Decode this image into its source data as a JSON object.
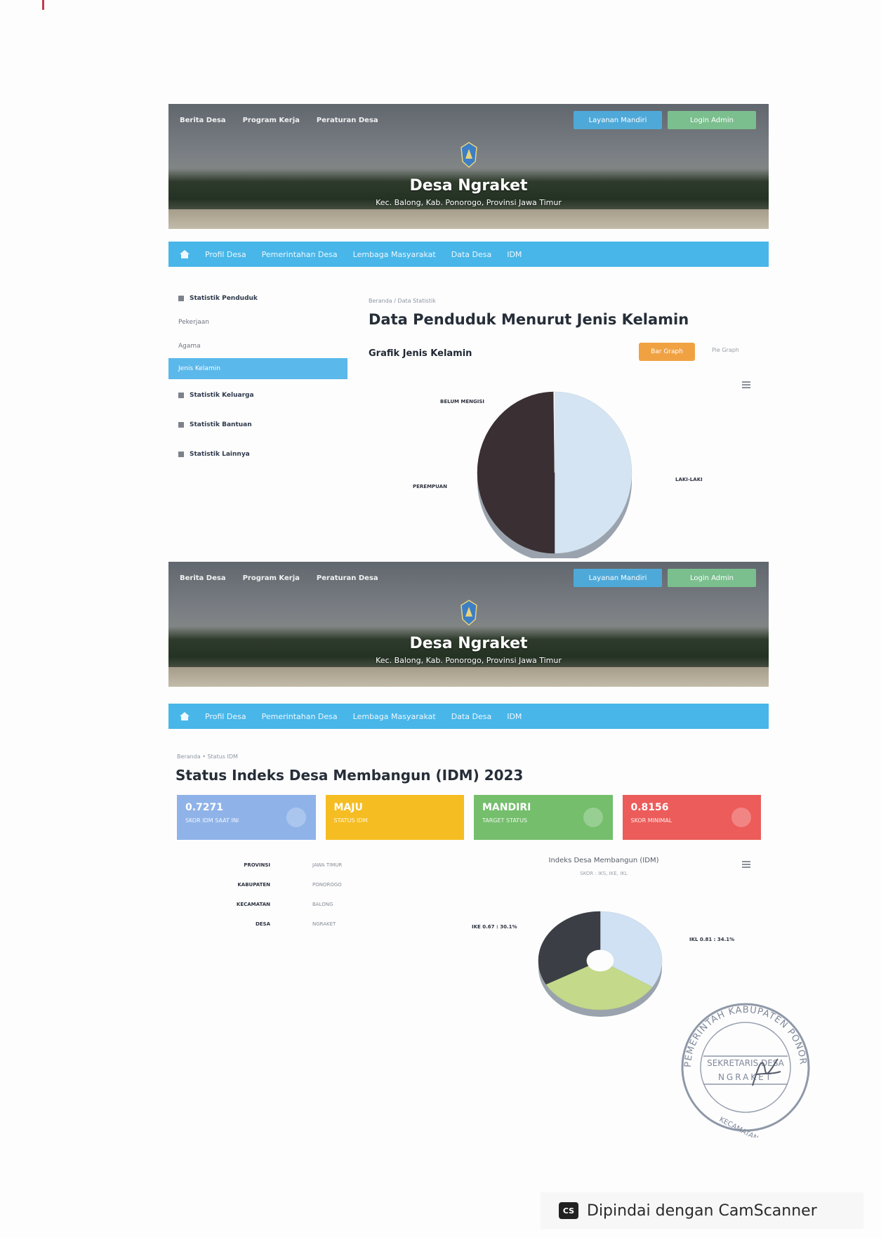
{
  "header": {
    "nav": [
      "Berita Desa",
      "Program Kerja",
      "Peraturan Desa"
    ],
    "btn_layanan": "Layanan Mandiri",
    "btn_login": "Login Admin",
    "title": "Desa Ngraket",
    "subtitle": "Kec. Balong, Kab. Ponorogo, Provinsi Jawa Timur"
  },
  "mainnav": {
    "items": [
      "Profil Desa",
      "Pemerintahan Desa",
      "Lembaga Masyarakat",
      "Data Desa",
      "IDM"
    ]
  },
  "sidebar": {
    "items": [
      "Statistik Penduduk",
      "Pekerjaan",
      "Agama",
      "Jenis Kelamin",
      "Statistik Keluarga",
      "Statistik Bantuan",
      "Statistik Lainnya"
    ]
  },
  "section1": {
    "breadcrumb": "Beranda / Data Statistik",
    "title": "Data Penduduk Menurut Jenis Kelamin",
    "chart_heading": "Grafik Jenis Kelamin",
    "btn_chart": "Bar Graph",
    "btn_pie": "Pie Graph"
  },
  "section2": {
    "breadcrumb": "Beranda • Status IDM",
    "title": "Status Indeks Desa Membangun (IDM) 2023",
    "cards": [
      {
        "value": "0.7271",
        "label": "SKOR IDM SAAT INI",
        "color": "#8fb3e8"
      },
      {
        "value": "MAJU",
        "label": "STATUS IDM",
        "color": "#f5bd22"
      },
      {
        "value": "MANDIRI",
        "label": "TARGET STATUS",
        "color": "#74be6c"
      },
      {
        "value": "0.8156",
        "label": "SKOR MINIMAL",
        "color": "#ec5c5a"
      }
    ],
    "info": [
      {
        "key": "PROVINSI",
        "value": "JAWA TIMUR"
      },
      {
        "key": "KABUPATEN",
        "value": "PONOROGO"
      },
      {
        "key": "KECAMATAN",
        "value": "BALONG"
      },
      {
        "key": "DESA",
        "value": "NGRAKET"
      }
    ],
    "chart_title": "Indeks Desa Membangun (IDM)",
    "chart_subtitle": "SKOR : IKS, IKE, IKL"
  },
  "chart_data": [
    {
      "type": "pie",
      "labels": [
        "LAKI-LAKI",
        "PEREMPUAN",
        "BELUM MENGISI"
      ],
      "values": [
        50,
        49.8,
        0.2
      ],
      "colors": [
        "#d4e4f2",
        "#3a2f32",
        "#ffffff"
      ]
    },
    {
      "type": "pie",
      "labels": [
        "IKL",
        "IKS",
        "IKE"
      ],
      "values": [
        34,
        33,
        33
      ],
      "colors": [
        "#cfe1f2",
        "#c4d98a",
        "#3b3f45"
      ],
      "slice_labels": [
        "IKL 0.81 : 34.1%",
        "IKE 0.67 : 30.1%"
      ]
    }
  ],
  "stamp": {
    "outer": "PEMERINTAH KABUPATEN PONOROGO",
    "inner": "SEKRETARIS DESA",
    "place": "NGRAKET",
    "bottom": "KECAMATAN"
  },
  "footer": {
    "logo": "CS",
    "text": "Dipindai dengan CamScanner"
  }
}
